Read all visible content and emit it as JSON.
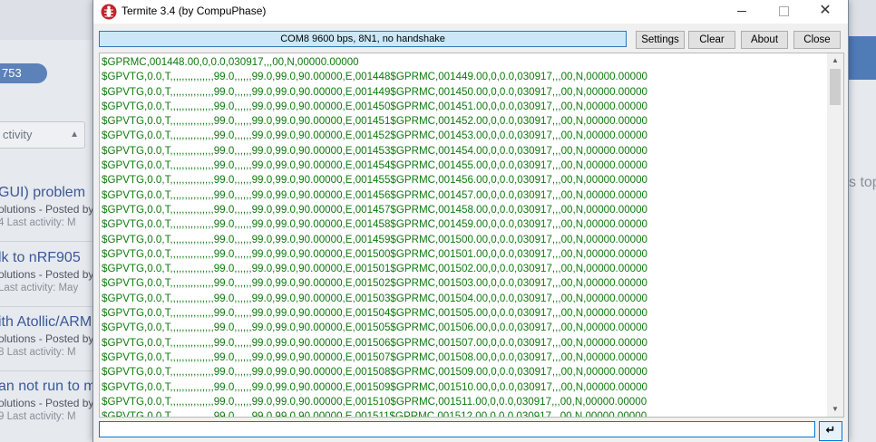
{
  "window": {
    "title": "Termite 3.4 (by CompuPhase)",
    "controls": {
      "minimize_icon": "minimize-icon",
      "maximize_icon": "maximize-icon",
      "close_glyph": "✕"
    }
  },
  "toolbar": {
    "status": "COM8 9600 bps, 8N1, no handshake",
    "settings_label": "Settings",
    "clear_label": "Clear",
    "about_label": "About",
    "close_label": "Close"
  },
  "terminal": {
    "lines": [
      "$GPRMC,001448.00,0,0.0,030917,,,00,N,00000.00000",
      "$GPVTG,0.0,T,,,,,,,,,,,,,,,99.0,,,,,,99.0,99.0,90.00000,E,001448$GPRMC,001449.00,0,0.0,030917,,,00,N,00000.00000",
      "$GPVTG,0.0,T,,,,,,,,,,,,,,,99.0,,,,,,99.0,99.0,90.00000,E,001449$GPRMC,001450.00,0,0.0,030917,,,00,N,00000.00000",
      "$GPVTG,0.0,T,,,,,,,,,,,,,,,99.0,,,,,,99.0,99.0,90.00000,E,001450$GPRMC,001451.00,0,0.0,030917,,,00,N,00000.00000",
      "$GPVTG,0.0,T,,,,,,,,,,,,,,,99.0,,,,,,99.0,99.0,90.00000,E,001451$GPRMC,001452.00,0,0.0,030917,,,00,N,00000.00000",
      "$GPVTG,0.0,T,,,,,,,,,,,,,,,99.0,,,,,,99.0,99.0,90.00000,E,001452$GPRMC,001453.00,0,0.0,030917,,,00,N,00000.00000",
      "$GPVTG,0.0,T,,,,,,,,,,,,,,,99.0,,,,,,99.0,99.0,90.00000,E,001453$GPRMC,001454.00,0,0.0,030917,,,00,N,00000.00000",
      "$GPVTG,0.0,T,,,,,,,,,,,,,,,99.0,,,,,,99.0,99.0,90.00000,E,001454$GPRMC,001455.00,0,0.0,030917,,,00,N,00000.00000",
      "$GPVTG,0.0,T,,,,,,,,,,,,,,,99.0,,,,,,99.0,99.0,90.00000,E,001455$GPRMC,001456.00,0,0.0,030917,,,00,N,00000.00000",
      "$GPVTG,0.0,T,,,,,,,,,,,,,,,99.0,,,,,,99.0,99.0,90.00000,E,001456$GPRMC,001457.00,0,0.0,030917,,,00,N,00000.00000",
      "$GPVTG,0.0,T,,,,,,,,,,,,,,,99.0,,,,,,99.0,99.0,90.00000,E,001457$GPRMC,001458.00,0,0.0,030917,,,00,N,00000.00000",
      "$GPVTG,0.0,T,,,,,,,,,,,,,,,99.0,,,,,,99.0,99.0,90.00000,E,001458$GPRMC,001459.00,0,0.0,030917,,,00,N,00000.00000",
      "$GPVTG,0.0,T,,,,,,,,,,,,,,,99.0,,,,,,99.0,99.0,90.00000,E,001459$GPRMC,001500.00,0,0.0,030917,,,00,N,00000.00000",
      "$GPVTG,0.0,T,,,,,,,,,,,,,,,99.0,,,,,,99.0,99.0,90.00000,E,001500$GPRMC,001501.00,0,0.0,030917,,,00,N,00000.00000",
      "$GPVTG,0.0,T,,,,,,,,,,,,,,,99.0,,,,,,99.0,99.0,90.00000,E,001501$GPRMC,001502.00,0,0.0,030917,,,00,N,00000.00000",
      "$GPVTG,0.0,T,,,,,,,,,,,,,,,99.0,,,,,,99.0,99.0,90.00000,E,001502$GPRMC,001503.00,0,0.0,030917,,,00,N,00000.00000",
      "$GPVTG,0.0,T,,,,,,,,,,,,,,,99.0,,,,,,99.0,99.0,90.00000,E,001503$GPRMC,001504.00,0,0.0,030917,,,00,N,00000.00000",
      "$GPVTG,0.0,T,,,,,,,,,,,,,,,99.0,,,,,,99.0,99.0,90.00000,E,001504$GPRMC,001505.00,0,0.0,030917,,,00,N,00000.00000",
      "$GPVTG,0.0,T,,,,,,,,,,,,,,,99.0,,,,,,99.0,99.0,90.00000,E,001505$GPRMC,001506.00,0,0.0,030917,,,00,N,00000.00000",
      "$GPVTG,0.0,T,,,,,,,,,,,,,,,99.0,,,,,,99.0,99.0,90.00000,E,001506$GPRMC,001507.00,0,0.0,030917,,,00,N,00000.00000",
      "$GPVTG,0.0,T,,,,,,,,,,,,,,,99.0,,,,,,99.0,99.0,90.00000,E,001507$GPRMC,001508.00,0,0.0,030917,,,00,N,00000.00000",
      "$GPVTG,0.0,T,,,,,,,,,,,,,,,99.0,,,,,,99.0,99.0,90.00000,E,001508$GPRMC,001509.00,0,0.0,030917,,,00,N,00000.00000",
      "$GPVTG,0.0,T,,,,,,,,,,,,,,,99.0,,,,,,99.0,99.0,90.00000,E,001509$GPRMC,001510.00,0,0.0,030917,,,00,N,00000.00000",
      "$GPVTG,0.0,T,,,,,,,,,,,,,,,99.0,,,,,,99.0,99.0,90.00000,E,001510$GPRMC,001511.00,0,0.0,030917,,,00,N,00000.00000",
      "$GPVTG,0.0,T,,,,,,,,,,,,,,,99.0,,,,,,99.0,99.0,90.00000,E,001511$GPRMC,001512.00,0,0.0,030917,,,00,N,00000.00000"
    ],
    "text_color": "#0f7a0f",
    "scroll_up_glyph": "▲",
    "scroll_down_glyph": "▼"
  },
  "input": {
    "value": "",
    "send_glyph": "↵"
  },
  "background": {
    "badge_count": "753",
    "filter_select": "ctivity",
    "right_partial_text": "s top",
    "topics": [
      {
        "title": "GUI) problem",
        "sub": "olutions - Posted by",
        "meta": "4    Last activity: M"
      },
      {
        "title": "lk to nRF905",
        "sub": "olutions - Posted by",
        "meta": "    Last activity: May"
      },
      {
        "title": "ith Atollic/ARM",
        "sub": "olutions - Posted by",
        "meta": "8    Last activity: M"
      },
      {
        "title": "an not run to m",
        "sub": "olutions - Posted by",
        "meta": "9    Last activity: M"
      }
    ]
  }
}
